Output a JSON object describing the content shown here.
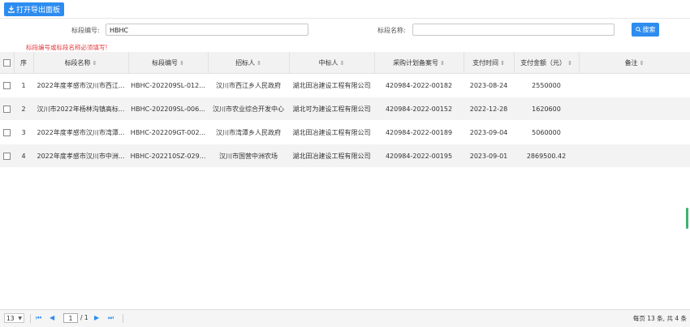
{
  "toolbar": {
    "export_label": "打开导出面板"
  },
  "filters": {
    "code_label": "标段编号:",
    "code_value": "HBHC",
    "name_label": "标段名称:",
    "name_value": "",
    "search_label": "搜索",
    "warning": "标段编号或标段名称必须填写!"
  },
  "table": {
    "headers": {
      "seq": "序",
      "name": "标段名称",
      "code": "标段编号",
      "tenderer": "招标人",
      "winner": "中标人",
      "plan": "采购计划备案号",
      "paytime": "支付时间",
      "amount": "支付金额（元）",
      "remark": "备注"
    },
    "rows": [
      {
        "seq": "1",
        "name": "2022年度孝感市汉川市西江...",
        "code": "HBHC-202209SL-012...",
        "tenderer": "汉川市西江乡人民政府",
        "winner": "湖北田冶建设工程有限公司",
        "plan": "420984-2022-00182",
        "paytime": "2023-08-24",
        "amount": "2550000",
        "remark": ""
      },
      {
        "seq": "2",
        "name": "汉川市2022年杨林沟镇高标...",
        "code": "HBHC-202209SL-006...",
        "tenderer": "汉川市农业综合开发中心",
        "winner": "湖北可为建设工程有限公司",
        "plan": "420984-2022-00152",
        "paytime": "2022-12-28",
        "amount": "1620600",
        "remark": ""
      },
      {
        "seq": "3",
        "name": "2022年度孝感市汉川市湾潭...",
        "code": "HBHC-202209GT-002...",
        "tenderer": "汉川市湾潭乡人民政府",
        "winner": "湖北田冶建设工程有限公司",
        "plan": "420984-2022-00189",
        "paytime": "2023-09-04",
        "amount": "5060000",
        "remark": ""
      },
      {
        "seq": "4",
        "name": "2022年度孝感市汉川市中洲...",
        "code": "HBHC-202210SZ-029...",
        "tenderer": "汉川市国营中洲农场",
        "winner": "湖北田冶建设工程有限公司",
        "plan": "420984-2022-00195",
        "paytime": "2023-09-01",
        "amount": "2869500.42",
        "remark": ""
      }
    ]
  },
  "pagination": {
    "page_size": "13",
    "current_page": "1",
    "total_pages": "/ 1",
    "info": "每页 13 条, 共 4 条"
  }
}
